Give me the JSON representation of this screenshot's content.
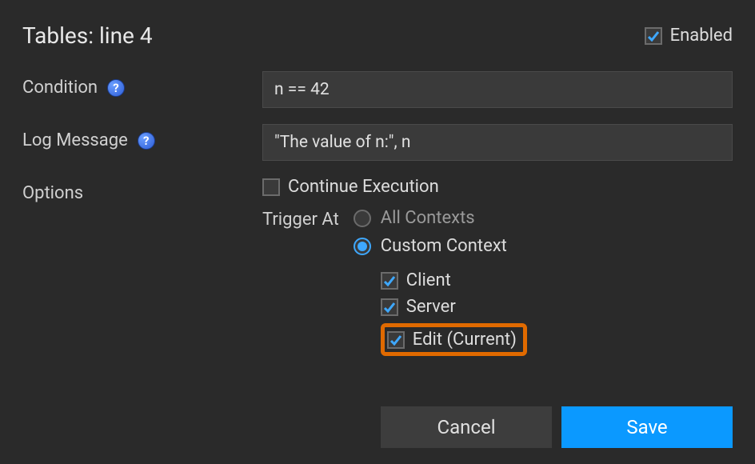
{
  "header": {
    "title": "Tables: line 4",
    "enabled_label": "Enabled",
    "enabled_checked": true
  },
  "fields": {
    "condition": {
      "label": "Condition",
      "value": "n == 42"
    },
    "log_message": {
      "label": "Log Message",
      "value": "\"The value of n:\", n"
    },
    "options": {
      "label": "Options",
      "continue_execution": {
        "label": "Continue Execution",
        "checked": false
      },
      "trigger_at": {
        "label": "Trigger At",
        "selected": "custom",
        "all_contexts_label": "All Contexts",
        "custom_context_label": "Custom Context",
        "contexts": {
          "client": {
            "label": "Client",
            "checked": true
          },
          "server": {
            "label": "Server",
            "checked": true
          },
          "edit": {
            "label": "Edit (Current)",
            "checked": true
          }
        }
      }
    }
  },
  "buttons": {
    "cancel": "Cancel",
    "save": "Save"
  },
  "icons": {
    "help": "?",
    "check_color": "#3ea8ff"
  }
}
